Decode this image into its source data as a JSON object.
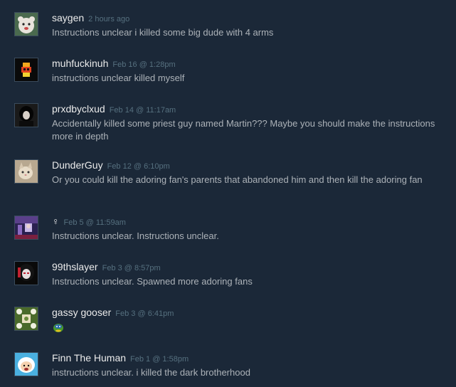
{
  "comments": [
    {
      "author": "saygen",
      "time": "2 hours ago",
      "text": "Instructions unclear i killed some big dude with 4 arms",
      "avatar": "white-bear-avatar"
    },
    {
      "author": "muhfuckinuh",
      "time": "Feb 16 @ 1:28pm",
      "text": "instructions unclear killed myself",
      "avatar": "pixel-character-avatar"
    },
    {
      "author": "prxdbyclxud",
      "time": "Feb 14 @ 11:17am",
      "text": "Accidentally killed some priest guy named Martin??? Maybe you should make the instructions more in depth",
      "avatar": "dark-hair-avatar"
    },
    {
      "author": "DunderGuy",
      "time": "Feb 12 @ 6:10pm",
      "text": "Or you could kill the adoring fan's parents that abandoned him and then kill the adoring fan",
      "avatar": "cat-avatar"
    },
    {
      "author": "♀",
      "time": "Feb 5 @ 11:59am",
      "text": "Instructions unclear. Instructions unclear.",
      "avatar": "anime-room-avatar"
    },
    {
      "author": "99thslayer",
      "time": "Feb 3 @ 8:57pm",
      "text": "Instructions unclear. Spawned more adoring fans",
      "avatar": "anime-girl-avatar"
    },
    {
      "author": "gassy gooser",
      "time": "Feb 3 @ 6:41pm",
      "text": "",
      "avatar": "flower-frame-avatar",
      "emoticon": "green-blob-emoticon"
    },
    {
      "author": "Finn The Human",
      "time": "Feb 1 @ 1:58pm",
      "text": "instructions unclear. i killed the dark brotherhood",
      "avatar": "finn-avatar"
    }
  ]
}
